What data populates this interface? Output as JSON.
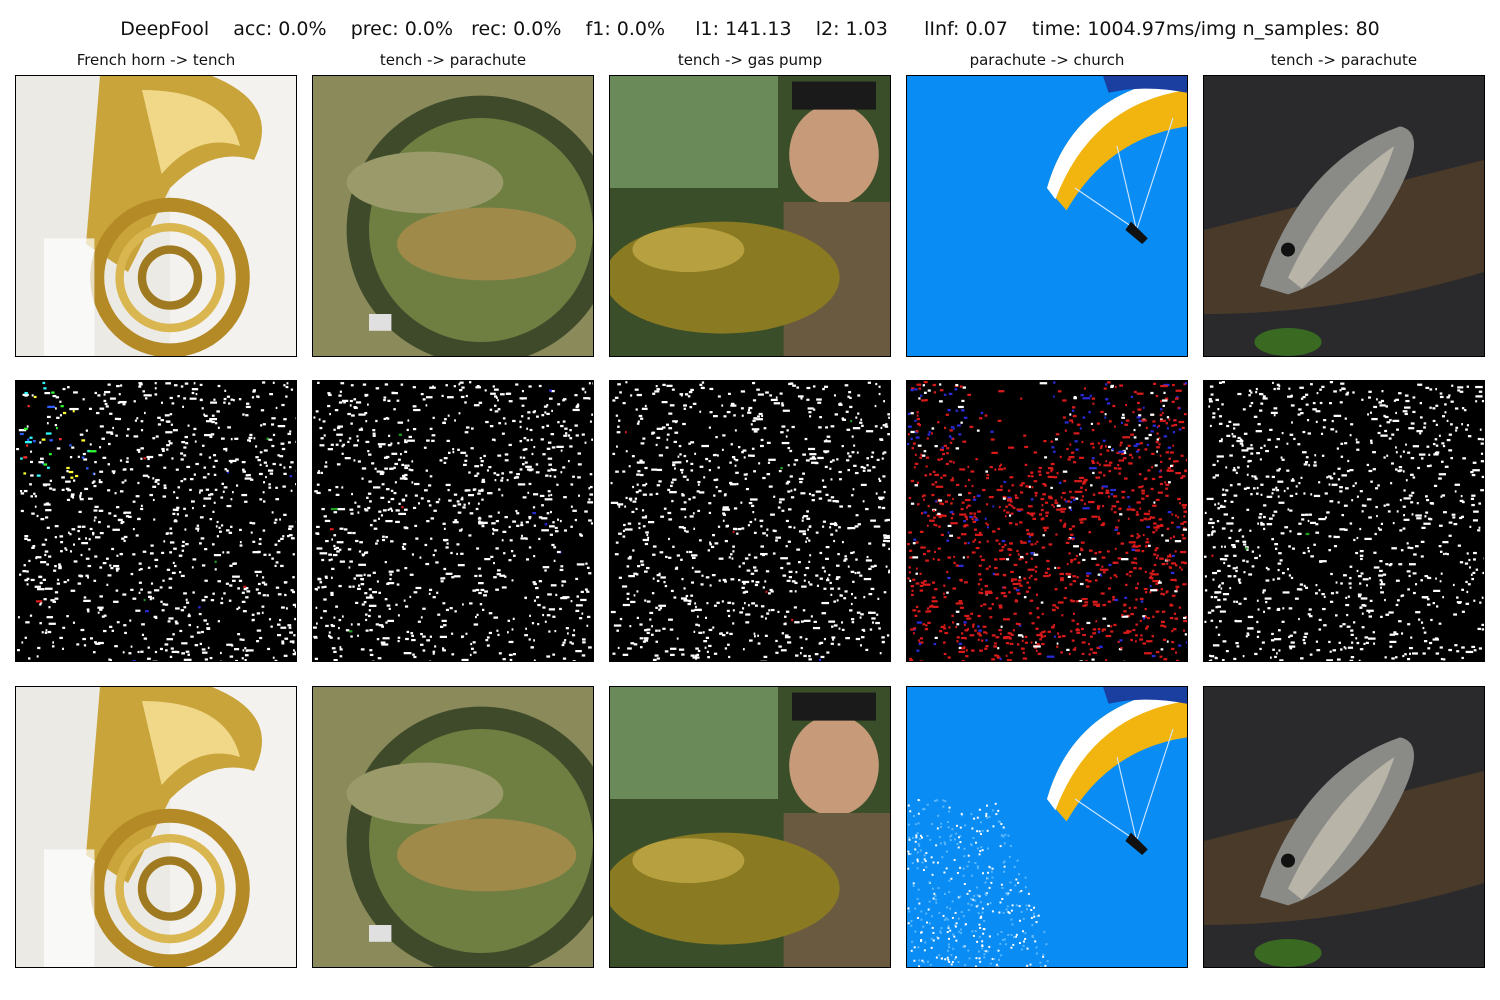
{
  "header": {
    "method": "DeepFool",
    "stats": [
      {
        "label": "acc",
        "value": "0.0%"
      },
      {
        "label": "prec",
        "value": "0.0%"
      },
      {
        "label": "rec",
        "value": "0.0%"
      },
      {
        "label": "f1",
        "value": "0.0%"
      },
      {
        "label": "l1",
        "value": "141.13"
      },
      {
        "label": "l2",
        "value": "1.03"
      },
      {
        "label": "lInf",
        "value": "0.07"
      },
      {
        "label": "time",
        "value": "1004.97ms/img"
      },
      {
        "label": "n_samples",
        "value": "80"
      }
    ],
    "texts": {
      "method": "DeepFool",
      "acc": "acc: 0.0%",
      "prec": "prec: 0.0%",
      "rec": "rec: 0.0%",
      "f1": "f1: 0.0%",
      "l1": "l1: 141.13",
      "l2": "l2: 1.03",
      "linf": "lInf: 0.07",
      "time": "time: 1004.97ms/img",
      "n_samples": "n_samples: 80"
    }
  },
  "columns": [
    {
      "title": "French horn -> tench",
      "subject": "french-horn",
      "noise": "bw-colorfringe"
    },
    {
      "title": "tench -> parachute",
      "subject": "tench-net",
      "noise": "bw"
    },
    {
      "title": "tench -> gas pump",
      "subject": "angler-tench",
      "noise": "bw"
    },
    {
      "title": "parachute -> church",
      "subject": "paraglider",
      "noise": "red"
    },
    {
      "title": "tench -> parachute",
      "subject": "carp",
      "noise": "bw"
    }
  ],
  "rows": [
    "original",
    "perturbation",
    "adversarial"
  ],
  "colors": {
    "sky_blue": "#0a8cf5",
    "brass": "#c9a43a",
    "noise_red": "#d81a1a"
  }
}
